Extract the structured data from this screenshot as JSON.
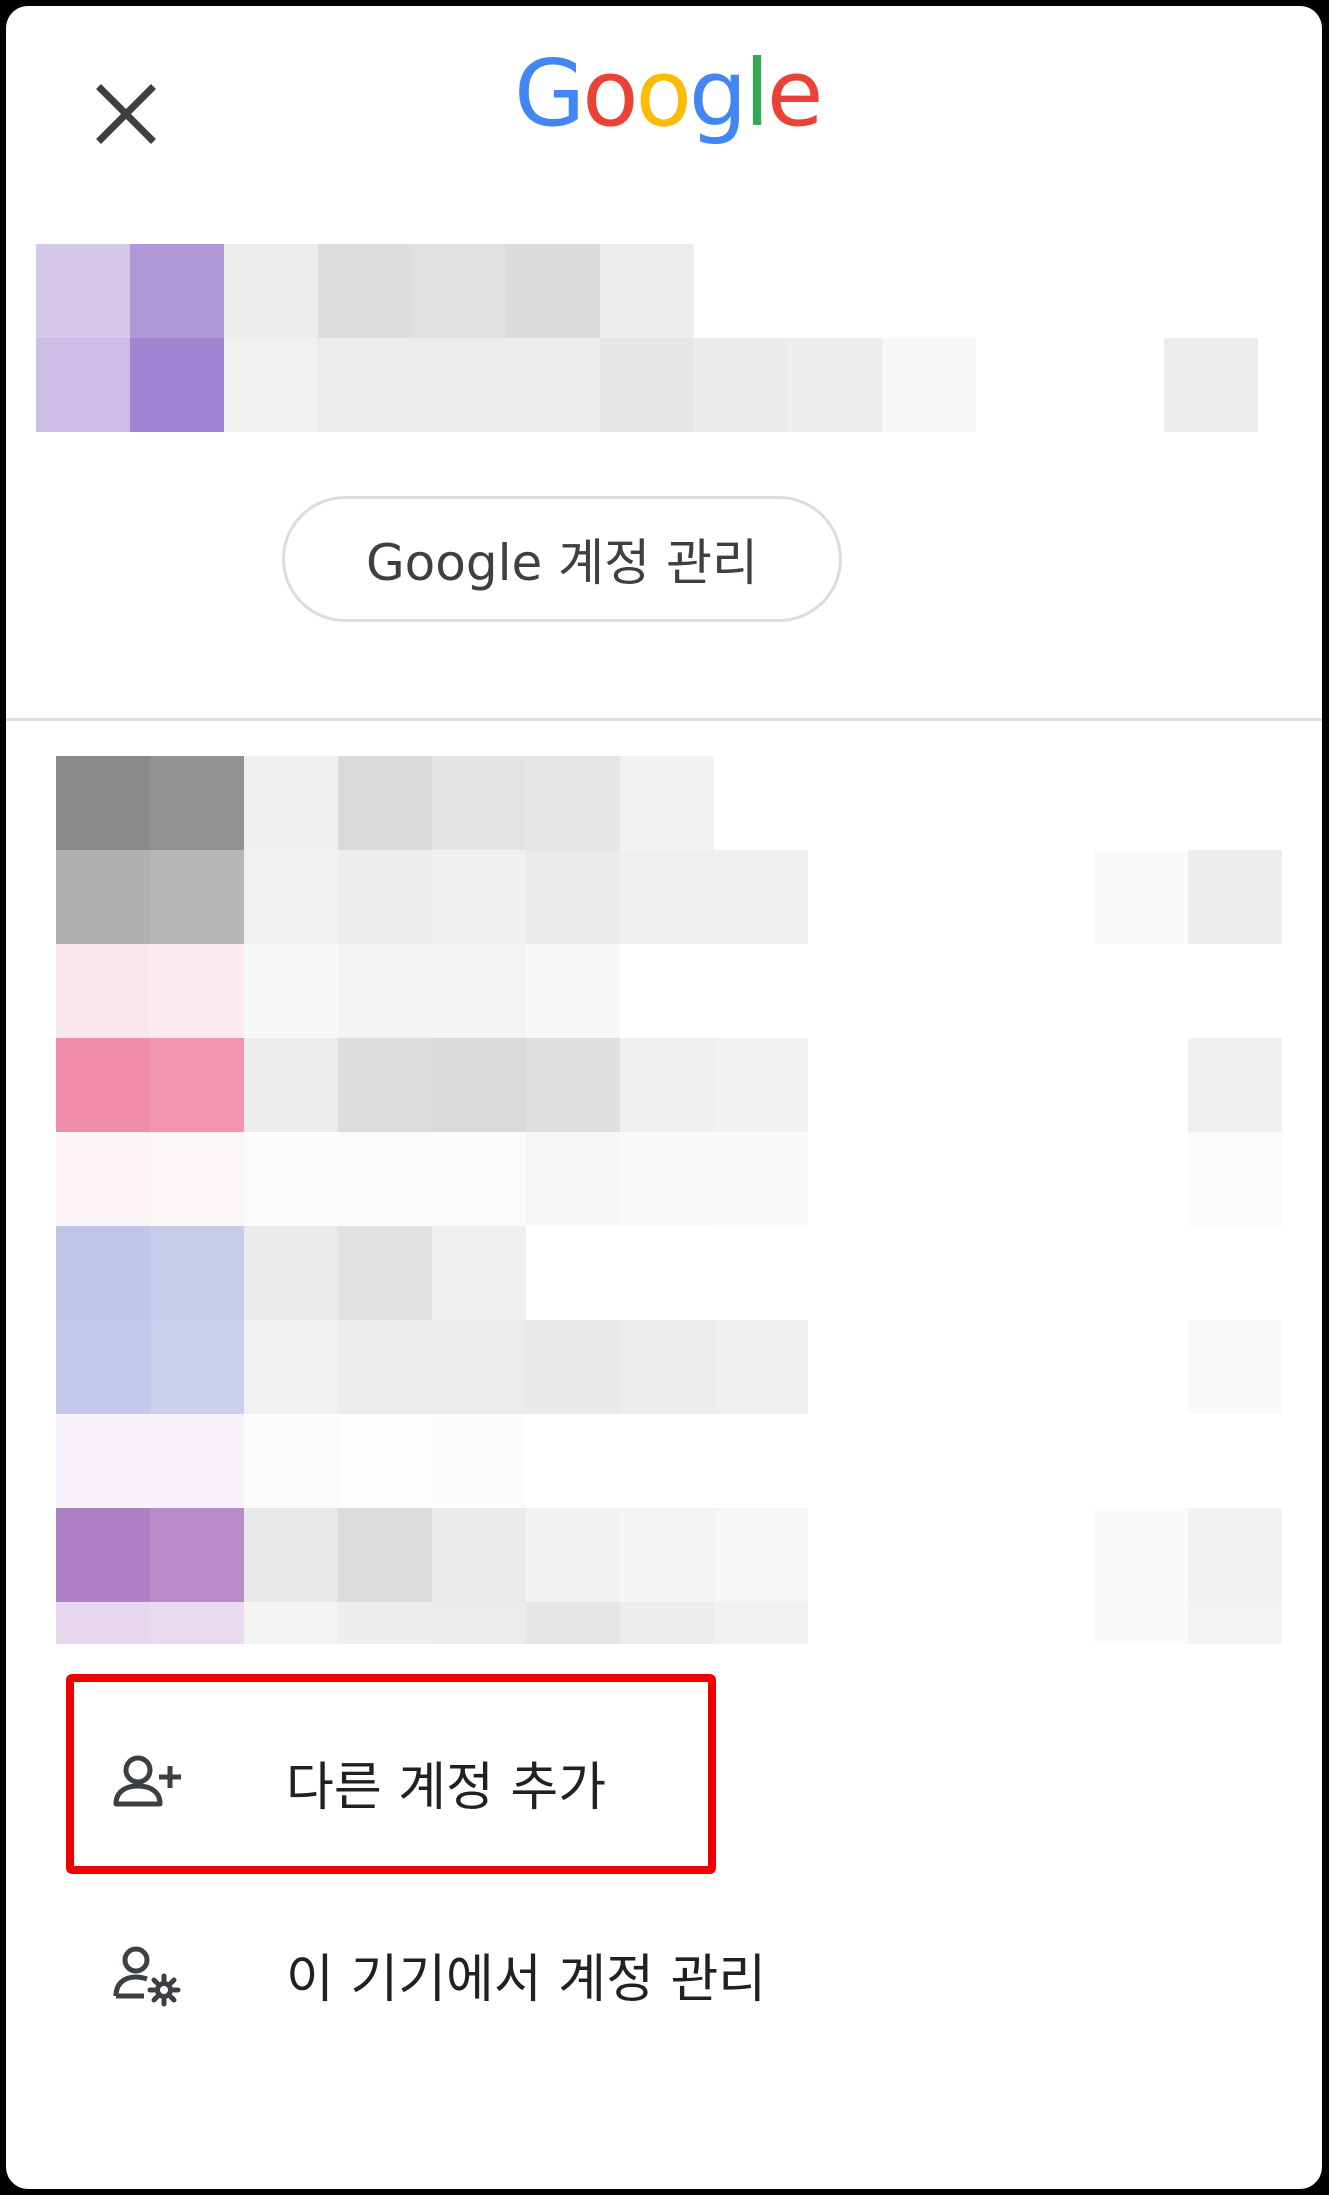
{
  "header": {
    "close_icon": "close-icon",
    "logo": {
      "letters": [
        "G",
        "o",
        "o",
        "g",
        "l",
        "e"
      ],
      "colors": [
        "#4285F4",
        "#EA4335",
        "#FBBC05",
        "#4285F4",
        "#34A853",
        "#EA4335"
      ]
    }
  },
  "account": {
    "manage_label": "Google 계정 관리"
  },
  "menu": {
    "add_account_label": "다른 계정 추가",
    "add_account_icon": "add-person-icon",
    "manage_device_label": "이 기기에서 계정 관리",
    "manage_device_icon": "person-settings-icon"
  },
  "colors": {
    "highlight": "#F10000",
    "divider": "#DADCE0",
    "text": "#202124"
  }
}
